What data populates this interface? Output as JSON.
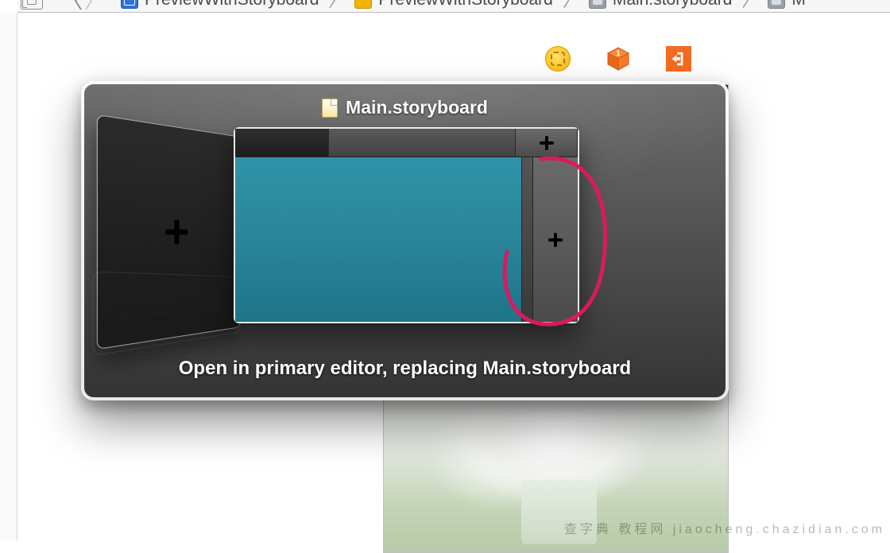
{
  "pathbar": {
    "crumbs": [
      {
        "label": "PreviewWithStoryboard"
      },
      {
        "label": "PreviewWithStoryboard"
      },
      {
        "label": "Main.storyboard"
      },
      {
        "label": "M"
      }
    ]
  },
  "hud": {
    "file_name": "Main.storyboard",
    "hint": "Open in primary editor, replacing Main.storyboard"
  },
  "watermark": "查字典 教程网 jiaocheng.chazidian.com",
  "icons": {
    "sun": "assistant-editor-icon",
    "cube": "3d-cube-icon",
    "exit": "exit-icon"
  }
}
